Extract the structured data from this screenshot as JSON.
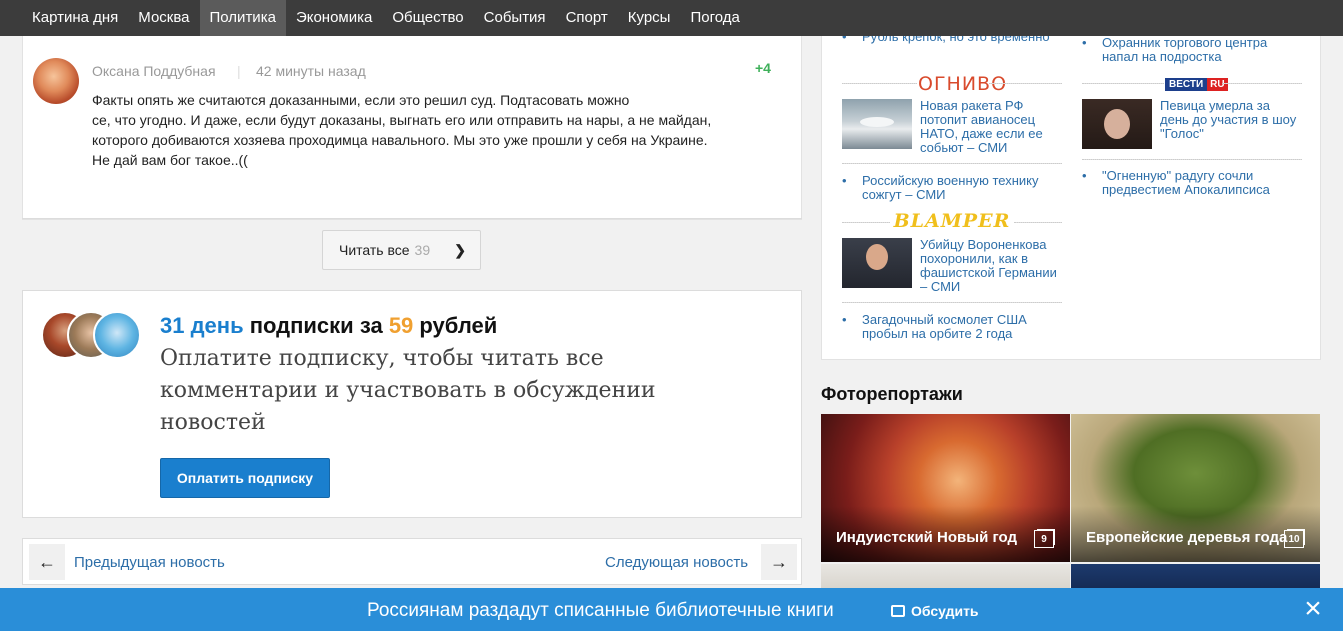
{
  "nav": {
    "items": [
      {
        "label": "Картина дня"
      },
      {
        "label": "Москва"
      },
      {
        "label": "Политика"
      },
      {
        "label": "Экономика"
      },
      {
        "label": "Общество"
      },
      {
        "label": "События"
      },
      {
        "label": "Спорт"
      },
      {
        "label": "Курсы"
      },
      {
        "label": "Погода"
      }
    ],
    "active": "Политика"
  },
  "comment": {
    "author": "Оксана Поддубная",
    "separator": "|",
    "time": "42 минуты назад",
    "score": "+4",
    "lines": [
      "Факты опять же считаются доказанными, если это решил суд. Подтасовать можно",
      "се, что угодно. И даже, если будут доказаны, выгнать его или отправить на нары, а не майдан,",
      "которого добиваются хозяева проходимца навального. Мы это уже прошли у себя на Украине.",
      "Не дай вам бог такое..(("
    ]
  },
  "read_all": {
    "label": "Читать все",
    "count": "39"
  },
  "promo": {
    "days": "31 день",
    "mid": " подписки за ",
    "price": "59",
    "tail": " рублей",
    "subtitle": "Оплатите подписку, чтобы читать все комментарии и участвовать в обсуждении новостей",
    "button": "Оплатить подписку"
  },
  "pager": {
    "prev": "Предыдущая новость",
    "next": "Следующая новость"
  },
  "sidebar_news": {
    "left_top_partial": "Рубль крепок, но это временно",
    "ognivo": "ОГНИВО",
    "ognivo_headline": "Новая ракета РФ потопит авианосец НАТО, даже если ее собьют – СМИ",
    "ognivo_link": "Российскую военную технику сожгут – СМИ",
    "blamper": "BLAMPER",
    "blamper_headline": "Убийцу Вороненкова похоронили, как в фашистской Германии – СМИ",
    "blamper_link": "Загадочный космолет США пробыл на орбите 2 года",
    "right_top": "Охранник торгового центра напал на подростка",
    "vesti_a": "ВЕСТИ",
    "vesti_b": "RU",
    "vesti_headline": "Певица умерла за день до участия в шоу \"Голос\"",
    "vesti_link": "\"Огненную\" радугу сочли предвестием Апокалипсиса"
  },
  "photo": {
    "title": "Фоторепортажи",
    "tiles": [
      {
        "caption": "Индуистский Новый год",
        "count": "9"
      },
      {
        "caption": "Европейские деревья года",
        "count": "10"
      }
    ]
  },
  "bottom_bar": {
    "text": "Россиянам раздадут списанные библиотечные книги",
    "discuss": "Обсудить",
    "close": "×"
  },
  "colors": {
    "nav_bg": "#3c3c3c",
    "accent_blue": "#1a7fce",
    "accent_orange": "#f0a030",
    "score_green": "#3eb05a",
    "bottom_bar": "#2a8ed8"
  }
}
